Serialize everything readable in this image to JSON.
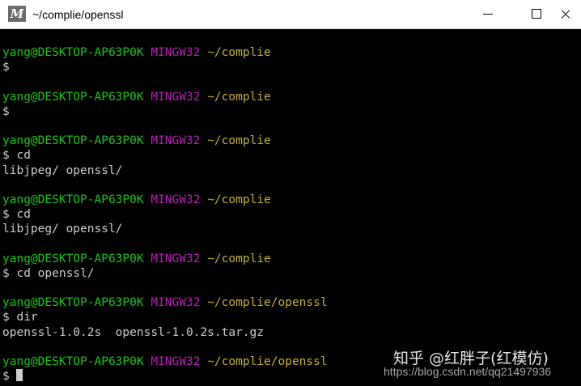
{
  "window": {
    "app_icon_letter": "M",
    "title": "~/complie/openssl"
  },
  "terminal": {
    "lines": [
      {
        "kind": "prompt",
        "user": "yang@DESKTOP-AP63P0K",
        "host": "MINGW32",
        "path": "~/complie"
      },
      {
        "kind": "text",
        "text": "$"
      },
      {
        "kind": "blank"
      },
      {
        "kind": "prompt",
        "user": "yang@DESKTOP-AP63P0K",
        "host": "MINGW32",
        "path": "~/complie"
      },
      {
        "kind": "text",
        "text": "$"
      },
      {
        "kind": "blank"
      },
      {
        "kind": "prompt",
        "user": "yang@DESKTOP-AP63P0K",
        "host": "MINGW32",
        "path": "~/complie"
      },
      {
        "kind": "text",
        "text": "$ cd"
      },
      {
        "kind": "text",
        "text": "libjpeg/ openssl/"
      },
      {
        "kind": "blank"
      },
      {
        "kind": "prompt",
        "user": "yang@DESKTOP-AP63P0K",
        "host": "MINGW32",
        "path": "~/complie"
      },
      {
        "kind": "text",
        "text": "$ cd"
      },
      {
        "kind": "text",
        "text": "libjpeg/ openssl/"
      },
      {
        "kind": "blank"
      },
      {
        "kind": "prompt",
        "user": "yang@DESKTOP-AP63P0K",
        "host": "MINGW32",
        "path": "~/complie"
      },
      {
        "kind": "text",
        "text": "$ cd openssl/"
      },
      {
        "kind": "blank"
      },
      {
        "kind": "prompt",
        "user": "yang@DESKTOP-AP63P0K",
        "host": "MINGW32",
        "path": "~/complie/openssl"
      },
      {
        "kind": "text",
        "text": "$ dir"
      },
      {
        "kind": "text",
        "text": "openssl-1.0.2s  openssl-1.0.2s.tar.gz"
      },
      {
        "kind": "blank"
      },
      {
        "kind": "prompt",
        "user": "yang@DESKTOP-AP63P0K",
        "host": "MINGW32",
        "path": "~/complie/openssl"
      },
      {
        "kind": "cursor",
        "text": "$ "
      }
    ]
  },
  "watermark": {
    "main": "知乎 @红胖子(红模仿)",
    "url": "https://blog.csdn.net/qq21497936"
  }
}
